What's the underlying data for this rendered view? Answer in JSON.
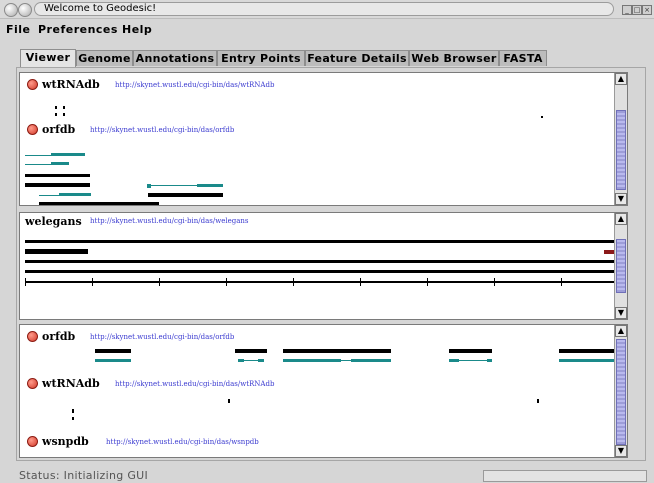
{
  "window": {
    "title": "Welcome to Geodesic!"
  },
  "menu": [
    "File",
    "Preferences",
    "Help"
  ],
  "tabs": [
    "Viewer",
    "Genome",
    "Annotations",
    "Entry Points",
    "Feature Details",
    "Web Browser",
    "FASTA"
  ],
  "top_panel": {
    "tracks": [
      {
        "name": "wtRNAdb",
        "url": "http://skynet.wustl.edu/cgi-bin/das/wtRNAdb"
      },
      {
        "name": "orfdb",
        "url": "http://skynet.wustl.edu/cgi-bin/das/orfdb"
      }
    ]
  },
  "middle_panel": {
    "track": {
      "name": "welegans",
      "url": "http://skynet.wustl.edu/cgi-bin/das/welegans"
    }
  },
  "bottom_panel": {
    "tracks": [
      {
        "name": "orfdb",
        "url": "http://skynet.wustl.edu/cgi-bin/das/orfdb"
      },
      {
        "name": "wtRNAdb",
        "url": "http://skynet.wustl.edu/cgi-bin/das/wtRNAdb"
      },
      {
        "name": "wsnpdb",
        "url": "http://skynet.wustl.edu/cgi-bin/das/wsnpdb"
      }
    ]
  },
  "status": {
    "text": "Status: Initializing GUI"
  },
  "colors": {
    "accent": "#3b3bd0",
    "feature": "#000000",
    "feature_alt": "#1a8a8a",
    "track_dot": "#d23a2a",
    "red_block": "#8b1a1a"
  }
}
